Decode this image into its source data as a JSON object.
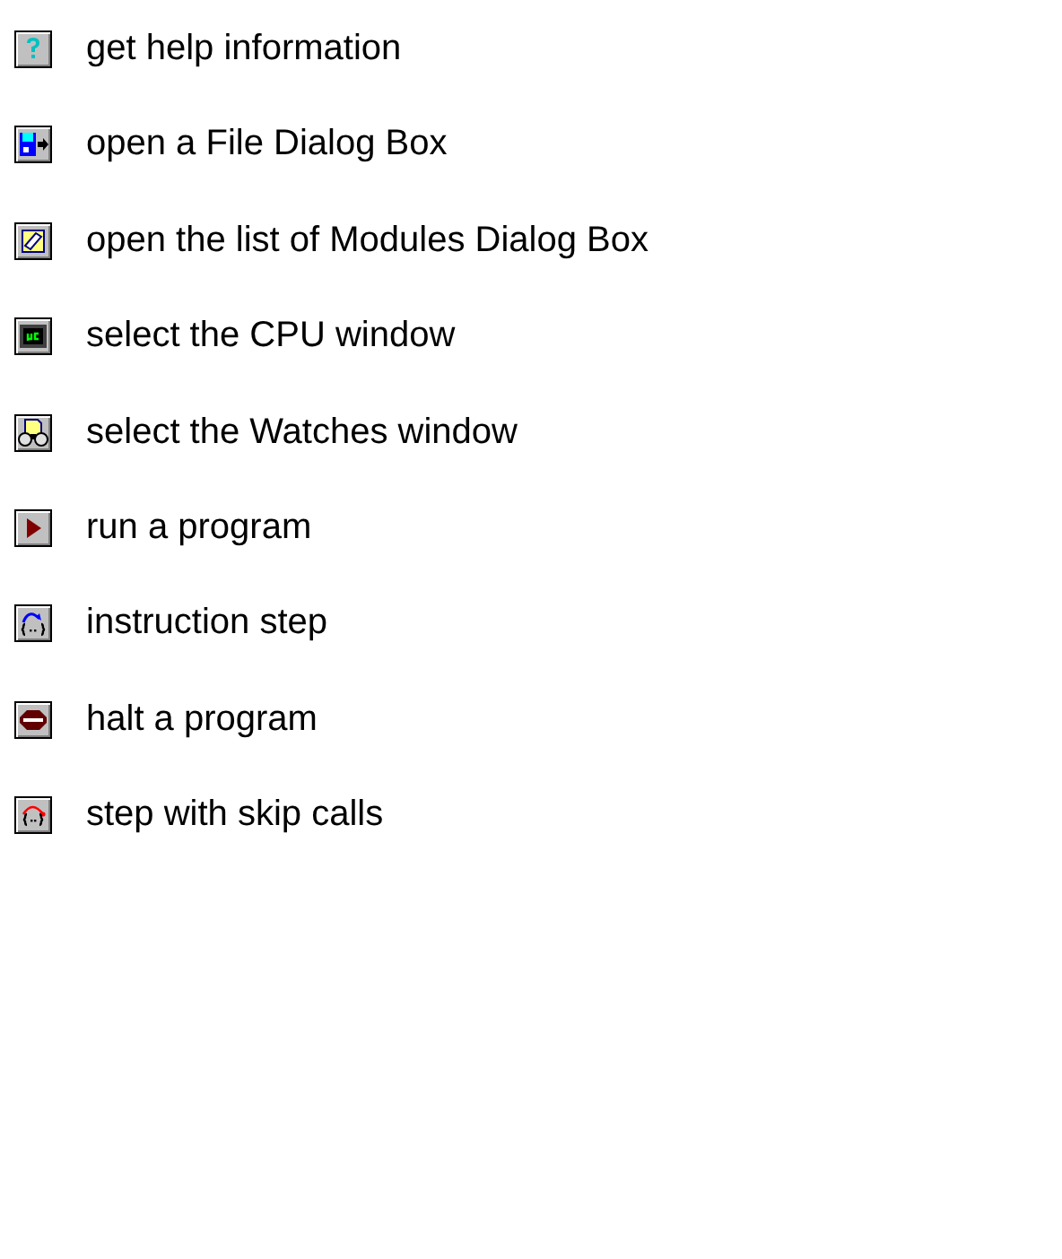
{
  "items": [
    {
      "kind": "help",
      "description": "get help information"
    },
    {
      "kind": "file",
      "description": "open a File Dialog Box"
    },
    {
      "kind": "modules",
      "description": "open the list of Modules Dialog Box"
    },
    {
      "kind": "cpu",
      "description": "select the CPU window"
    },
    {
      "kind": "watches",
      "description": "select the Watches window"
    },
    {
      "kind": "run",
      "description": "run a program"
    },
    {
      "kind": "step",
      "description": "instruction step"
    },
    {
      "kind": "halt",
      "description": "halt a program"
    },
    {
      "kind": "skip",
      "description": "step with skip calls"
    }
  ]
}
